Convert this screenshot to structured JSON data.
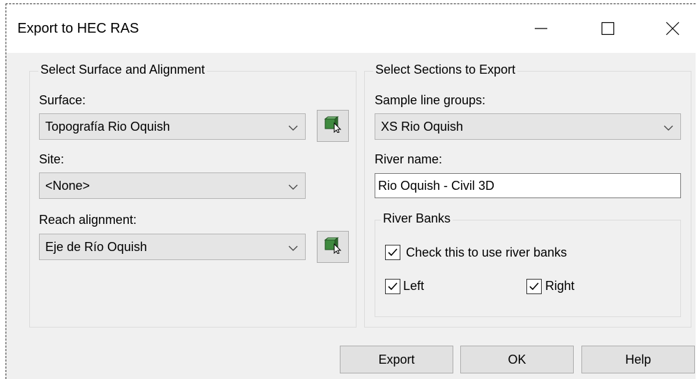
{
  "window": {
    "title": "Export to HEC RAS",
    "minimize_icon": "minimize-icon",
    "maximize_icon": "maximize-icon",
    "close_icon": "close-icon"
  },
  "left_group": {
    "title": "Select Surface and Alignment",
    "surface_label": "Surface:",
    "surface_value": "Topografía Rio Oquish",
    "site_label": "Site:",
    "site_value": "<None>",
    "reach_label": "Reach alignment:",
    "reach_value": "Eje de Río Oquish",
    "pick_icon": "pick-from-drawing-icon"
  },
  "right_group": {
    "title": "Select Sections to Export",
    "sample_label": "Sample line groups:",
    "sample_value": "XS Rio Oquish",
    "river_name_label": "River name:",
    "river_name_value": "Rio Oquish - Civil 3D"
  },
  "river_banks": {
    "title": "River Banks",
    "use_banks_label": "Check this to use river banks",
    "use_banks_checked": true,
    "left_label": "Left",
    "left_checked": true,
    "right_label": "Right",
    "right_checked": true
  },
  "buttons": {
    "export": "Export",
    "ok": "OK",
    "help": "Help"
  },
  "colors": {
    "dialog_bg": "#f0f0f0",
    "combo_bg": "#e5e5e5",
    "button_bg": "#e1e1e1",
    "pick_icon_green": "#3f8a3f"
  }
}
